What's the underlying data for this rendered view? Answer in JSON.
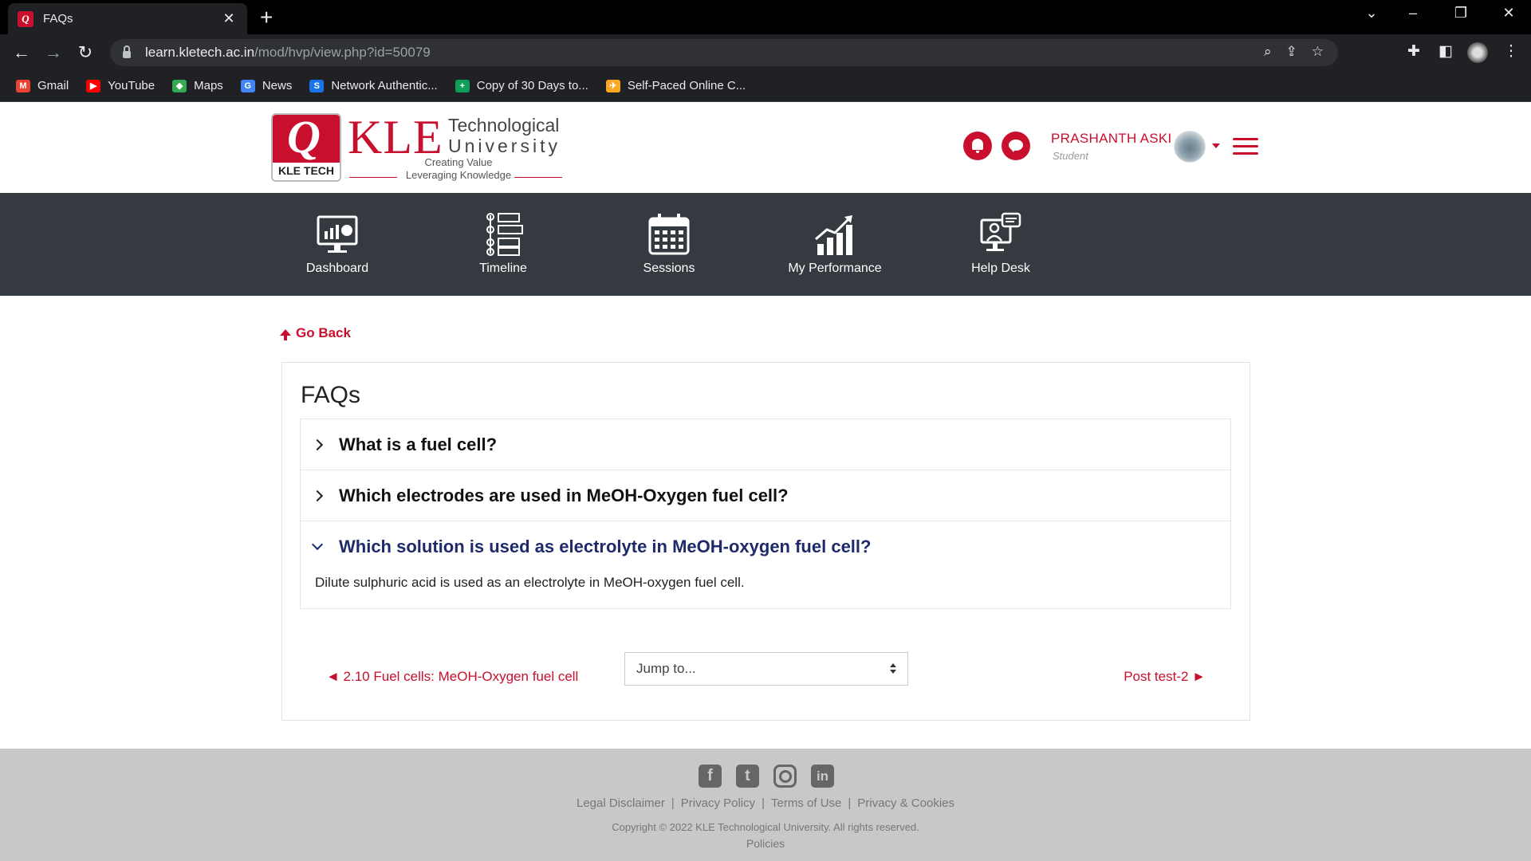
{
  "browser": {
    "tab_title": "FAQs",
    "url_host": "learn.kletech.ac.in",
    "url_path": "/mod/hvp/view.php?id=50079",
    "bookmarks": [
      {
        "label": "Gmail",
        "icon": "gmail-icon",
        "color": "#ea4335"
      },
      {
        "label": "YouTube",
        "icon": "youtube-icon",
        "color": "#ff0000"
      },
      {
        "label": "Maps",
        "icon": "maps-icon",
        "color": "#34a853"
      },
      {
        "label": "News",
        "icon": "news-icon",
        "color": "#4285f4"
      },
      {
        "label": "Network Authentic...",
        "icon": "network-auth-icon",
        "color": "#1a73e8"
      },
      {
        "label": "Copy of 30 Days to...",
        "icon": "sheets-icon",
        "color": "#0f9d58"
      },
      {
        "label": "Self-Paced Online C...",
        "icon": "course-icon",
        "color": "#f9a825"
      }
    ]
  },
  "header": {
    "logo": {
      "badge_text": "KLE TECH",
      "wordmark": "KLE",
      "line1": "Technological",
      "line2": "University",
      "tagline1": "Creating Value",
      "tagline2": "Leveraging Knowledge"
    },
    "user": {
      "name": "PRASHANTH ASKI",
      "role": "Student"
    },
    "brand_color": "#c8102e"
  },
  "nav": [
    {
      "label": "Dashboard",
      "icon": "dashboard-icon"
    },
    {
      "label": "Timeline",
      "icon": "timeline-icon"
    },
    {
      "label": "Sessions",
      "icon": "calendar-icon"
    },
    {
      "label": "My Performance",
      "icon": "performance-chart-icon"
    },
    {
      "label": "Help Desk",
      "icon": "help-desk-icon"
    }
  ],
  "main": {
    "go_back": "Go Back",
    "title": "FAQs",
    "faqs": [
      {
        "question": "What is a fuel cell?",
        "expanded": false
      },
      {
        "question": "Which electrodes are used in MeOH-Oxygen fuel cell?",
        "expanded": false
      },
      {
        "question": "Which solution is used as electrolyte in MeOH-oxygen fuel cell?",
        "expanded": true,
        "answer": "Dilute sulphuric acid is used as an electrolyte in MeOH-oxygen fuel cell."
      }
    ],
    "prev_link": "◄ 2.10 Fuel cells: MeOH-Oxygen fuel cell",
    "jump_placeholder": "Jump to...",
    "next_link": "Post test-2 ►"
  },
  "footer": {
    "social": [
      "facebook-icon",
      "twitter-icon",
      "instagram-icon",
      "linkedin-icon"
    ],
    "links": [
      "Legal Disclaimer",
      "Privacy Policy",
      "Terms of Use",
      "Privacy & Cookies"
    ],
    "copyright": "Copyright © 2022 KLE Technological University. All rights reserved.",
    "policies": "Policies"
  }
}
